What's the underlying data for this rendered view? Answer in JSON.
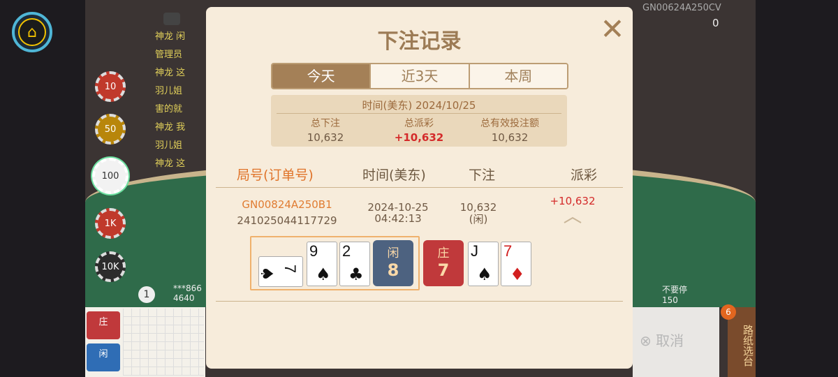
{
  "modal": {
    "title": "下注记录",
    "close_icon": "close-icon",
    "tabs": [
      "今天",
      "近3天",
      "本周"
    ],
    "active_tab": 0,
    "summary": {
      "date_label": "时间(美东) 2024/10/25",
      "total_bet_label": "总下注",
      "total_bet_value": "10,632",
      "total_payout_label": "总派彩",
      "total_payout_value": "+10,632",
      "total_valid_label": "总有效投注额",
      "total_valid_value": "10,632"
    },
    "columns": [
      "局号(订单号)",
      "时间(美东)",
      "下注",
      "派彩"
    ],
    "records": [
      {
        "round_no": "GN00824A250B1",
        "order_no": "241025044117729",
        "date": "2024-10-25",
        "time": "04:42:13",
        "bet": "10,632",
        "bet_side": "(闲)",
        "payout": "+10,632",
        "player": {
          "label": "闲",
          "score": "8",
          "cards": [
            {
              "rank": "7",
              "suit": "♠"
            },
            {
              "rank": "9",
              "suit": "♠"
            },
            {
              "rank": "2",
              "suit": "♣"
            }
          ]
        },
        "banker": {
          "label": "庄",
          "score": "7",
          "cards": [
            {
              "rank": "J",
              "suit": "♠"
            },
            {
              "rank": "7",
              "suit": "♦"
            }
          ]
        }
      }
    ]
  },
  "background": {
    "table_code": "GN00624A250CV",
    "balance": "0",
    "chat": [
      "神龙 闲",
      "管理员",
      "神龙 这",
      "羽儿姐",
      "害的就",
      "神龙 我",
      "羽儿姐",
      "神龙 这"
    ],
    "chips": [
      "10",
      "50",
      "100",
      "1K",
      "10K"
    ],
    "selected_chip": "100",
    "player_score_left": "***866",
    "player_amount_left": "4640",
    "round_number": "1",
    "right_text": "不要停",
    "right_amount": "150",
    "cancel_label": "取消",
    "roadmap_label": "路纸选台",
    "roadmap_badge": "6",
    "banker_btn": "庄",
    "player_btn": "闲",
    "home_icon": "home-icon"
  },
  "colors": {
    "modal_bg": "#f7ecdb",
    "accent": "#a48057",
    "payout_red": "#d42a2a",
    "order_orange": "#e07c32",
    "player_blue": "#4d6280",
    "banker_red": "#c0393b"
  }
}
